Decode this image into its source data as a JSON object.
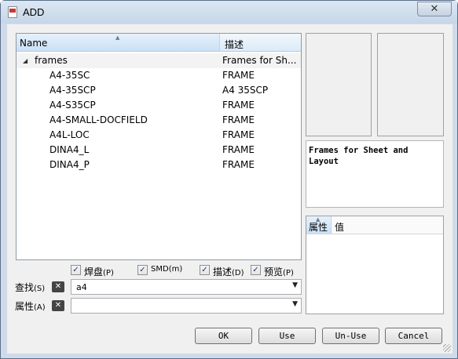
{
  "window": {
    "title": "ADD",
    "close_glyph": "✕"
  },
  "tree": {
    "columns": {
      "name": "Name",
      "description": "描述"
    },
    "folder": {
      "name": "frames",
      "description": "Frames for Sh..."
    },
    "items": [
      {
        "name": "A4-35SC",
        "description": "FRAME"
      },
      {
        "name": "A4-35SCP",
        "description": "A4 35SCP"
      },
      {
        "name": "A4-S35CP",
        "description": "FRAME"
      },
      {
        "name": "A4-SMALL-DOCFIELD",
        "description": "FRAME"
      },
      {
        "name": "A4L-LOC",
        "description": "FRAME"
      },
      {
        "name": "DINA4_L",
        "description": "FRAME"
      },
      {
        "name": "DINA4_P",
        "description": "FRAME"
      }
    ]
  },
  "description_text": "Frames for Sheet and\nLayout",
  "properties": {
    "col_property": "属性",
    "col_value": "值"
  },
  "options": {
    "pads": {
      "label": "焊盘",
      "key": "(P)",
      "checked": true
    },
    "smd": {
      "label": "SMD",
      "key": "(m)",
      "checked": true
    },
    "description": {
      "label": "描述",
      "key": "(D)",
      "checked": true
    },
    "preview": {
      "label": "预览",
      "key": "(P)",
      "checked": true
    }
  },
  "search": {
    "label": "查找",
    "key": "(S)",
    "value": "a4"
  },
  "attribute": {
    "label": "属性",
    "key": "(A)",
    "value": ""
  },
  "buttons": {
    "ok": "OK",
    "use": "Use",
    "unuse": "Un-Use",
    "cancel": "Cancel"
  },
  "colors": {
    "selection_header": "#c9e0f5",
    "frame": "#cfdbe9"
  }
}
